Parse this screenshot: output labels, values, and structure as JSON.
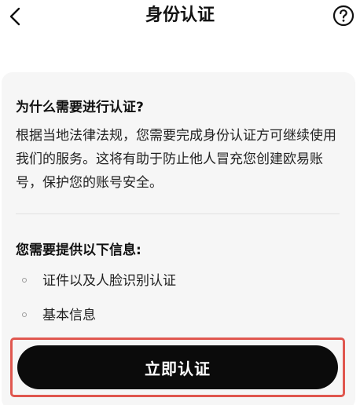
{
  "header": {
    "title": "身份认证",
    "back_icon": "chevron-left-icon",
    "help_icon": "question-circle-icon"
  },
  "card": {
    "why_title": "为什么需要进行认证?",
    "why_text": "根据当地法律法规，您需要完成身份认证方可继续使用我们的服务。这将有助于防止他人冒充您创建欧易账号，保护您的账号安全。",
    "info_title": "您需要提供以下信息:",
    "info_items": [
      {
        "label": "证件以及人脸识别认证"
      },
      {
        "label": "基本信息"
      }
    ]
  },
  "actions": {
    "verify_label": "立即认证"
  },
  "colors": {
    "card_bg": "#f6f6f6",
    "button_bg": "#0b0b0b",
    "highlight": "#e0574f"
  }
}
